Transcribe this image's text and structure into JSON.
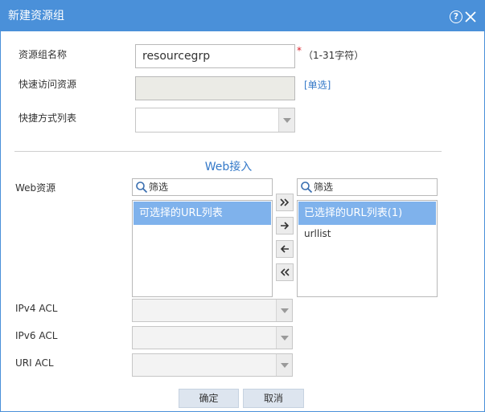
{
  "dialog": {
    "title": "新建资源组"
  },
  "form": {
    "name_label": "资源组名称",
    "name_value": "resourcegrp",
    "required_mark": "*",
    "name_hint": "（1-31字符）",
    "quick_access_label": "快速访问资源",
    "quick_access_link": "[单选]",
    "shortcut_label": "快捷方式列表"
  },
  "web": {
    "section_title": "Web接入",
    "resource_label": "Web资源",
    "filter_placeholder_left": "筛选",
    "filter_placeholder_right": "筛选",
    "available_header": "可选择的URL列表",
    "selected_header": "已选择的URL列表(1)",
    "selected_items": [
      "urllist"
    ]
  },
  "acl": {
    "ipv4_label": "IPv4 ACL",
    "ipv6_label": "IPv6 ACL",
    "uri_label": "URI ACL"
  },
  "buttons": {
    "ok": "确定",
    "cancel": "取消"
  },
  "colors": {
    "titlebar": "#4a90d9",
    "list_header": "#7fb2ec",
    "link": "#3378c8",
    "required": "#d9232e"
  }
}
